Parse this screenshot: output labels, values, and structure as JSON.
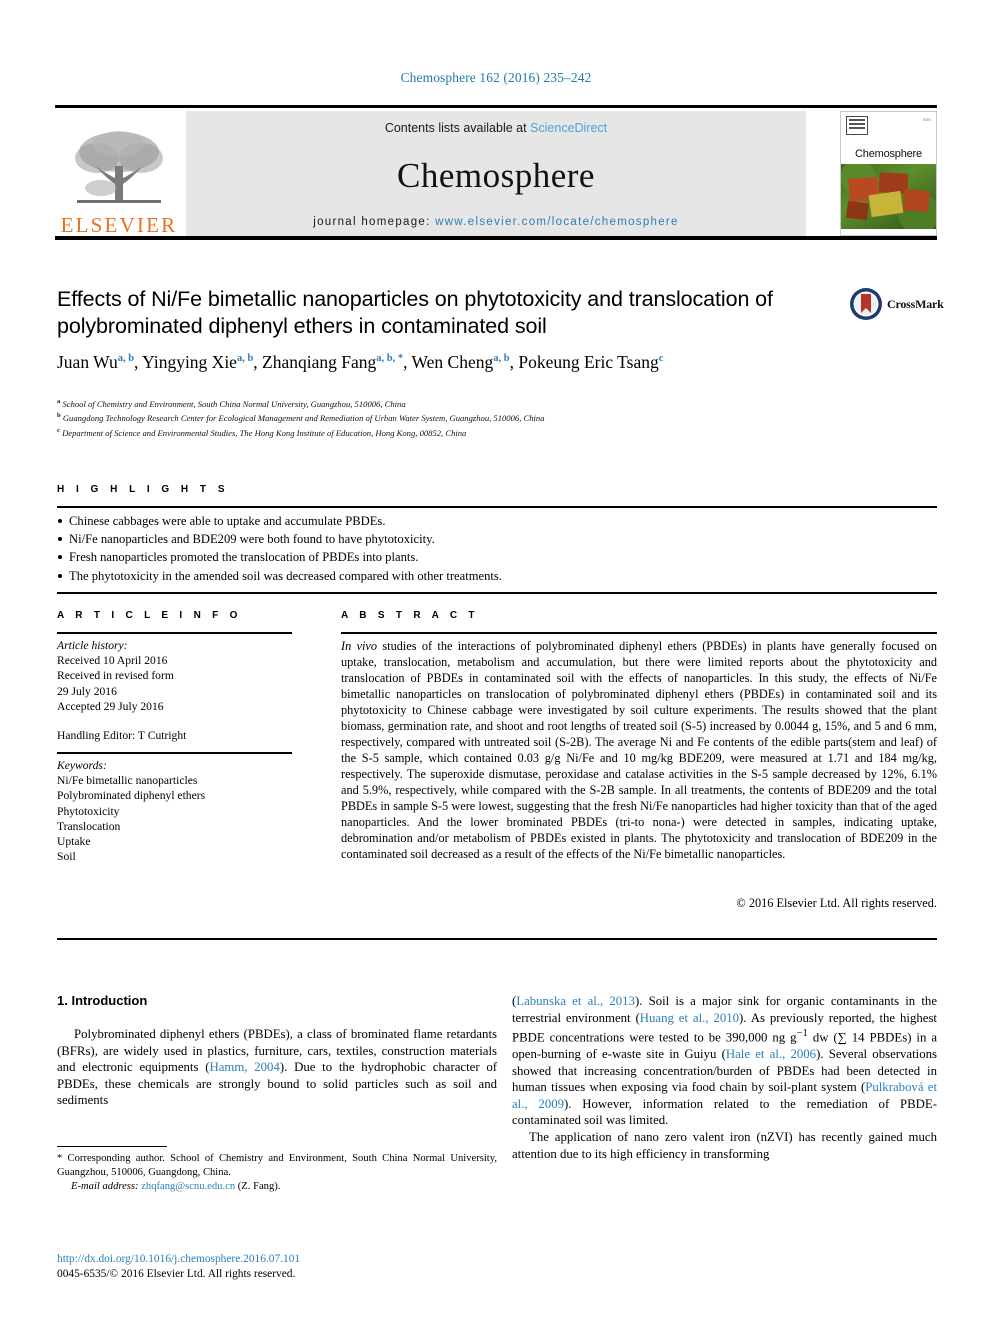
{
  "citation_line": "Chemosphere 162 (2016) 235–242",
  "masthead": {
    "publisher": "ELSEVIER",
    "contents_prefix": "Contents lists available at ",
    "contents_link": "ScienceDirect",
    "journal_name": "Chemosphere",
    "homepage_prefix": "journal homepage: ",
    "homepage_url": "www.elsevier.com/locate/chemosphere",
    "cover_title": "Chemosphere"
  },
  "article": {
    "title": "Effects of Ni/Fe bimetallic nanoparticles on phytotoxicity and translocation of polybrominated diphenyl ethers in contaminated soil",
    "crossmark_label": "CrossMark",
    "authors": [
      {
        "name": "Juan Wu",
        "marks": "a, b"
      },
      {
        "name": "Yingying Xie",
        "marks": "a, b"
      },
      {
        "name": "Zhanqiang Fang",
        "marks": "a, b, *"
      },
      {
        "name": "Wen Cheng",
        "marks": "a, b"
      },
      {
        "name": "Pokeung Eric Tsang",
        "marks": "c"
      }
    ],
    "affiliations": [
      {
        "mark": "a",
        "text": "School of Chemistry and Environment, South China Normal University, Guangzhou, 510006, China"
      },
      {
        "mark": "b",
        "text": "Guangdong Technology Research Center for Ecological Management and Remediation of Urban Water System, Guangzhou, 510006, China"
      },
      {
        "mark": "c",
        "text": "Department of Science and Environmental Studies, The Hong Kong Institute of Education, Hong Kong, 00852, China"
      }
    ]
  },
  "highlights": {
    "heading": "H I G H L I G H T S",
    "items": [
      "Chinese cabbages were able to uptake and accumulate PBDEs.",
      "Ni/Fe nanoparticles and BDE209 were both found to have phytotoxicity.",
      "Fresh nanoparticles promoted the translocation of PBDEs into plants.",
      "The phytotoxicity in the amended soil was decreased compared with other treatments."
    ]
  },
  "article_info": {
    "heading": "A R T I C L E   I N F O",
    "history_label": "Article history:",
    "history_lines": [
      "Received 10 April 2016",
      "Received in revised form",
      "29 July 2016",
      "Accepted 29 July 2016"
    ],
    "handling_editor": "Handling Editor: T Cutright",
    "keywords_label": "Keywords:",
    "keywords": [
      "Ni/Fe bimetallic nanoparticles",
      "Polybrominated diphenyl ethers",
      "Phytotoxicity",
      "Translocation",
      "Uptake",
      "Soil"
    ]
  },
  "abstract": {
    "heading": "A B S T R A C T",
    "lead_italic": "In vivo",
    "text": " studies of the interactions of polybrominated diphenyl ethers (PBDEs) in plants have generally focused on uptake, translocation, metabolism and accumulation, but there were limited reports about the phytotoxicity and translocation of PBDEs in contaminated soil with the effects of nanoparticles. In this study, the effects of Ni/Fe bimetallic nanoparticles on translocation of polybrominated diphenyl ethers (PBDEs) in contaminated soil and its phytotoxicity to Chinese cabbage were investigated by soil culture experiments. The results showed that the plant biomass, germination rate, and shoot and root lengths of treated soil (S-5) increased by 0.0044 g, 15%, and 5 and 6 mm, respectively, compared with untreated soil (S-2B). The average Ni and Fe contents of the edible parts(stem and leaf) of the S-5 sample, which contained 0.03 g/g Ni/Fe and 10 mg/kg BDE209, were measured at 1.71 and 184 mg/kg, respectively. The superoxide dismutase, peroxidase and catalase activities in the S-5 sample decreased by 12%, 6.1% and 5.9%, respectively, while compared with the S-2B sample. In all treatments, the contents of BDE209 and the total PBDEs in sample S-5 were lowest, suggesting that the fresh Ni/Fe nanoparticles had higher toxicity than that of the aged nanoparticles. And the lower brominated PBDEs (tri-to nona-) were detected in samples, indicating uptake, debromination and/or metabolism of PBDEs existed in plants. The phytotoxicity and translocation of BDE209 in the contaminated soil decreased as a result of the effects of the Ni/Fe bimetallic nanoparticles.",
    "copyright": "© 2016 Elsevier Ltd. All rights reserved."
  },
  "body": {
    "section_title": "1. Introduction",
    "left_para_1_a": "Polybrominated diphenyl ethers (PBDEs), a class of brominated flame retardants (BFRs), are widely used in plastics, furniture, cars, textiles, construction materials and electronic equipments (",
    "left_ref_1": "Hamm, 2004",
    "left_para_1_b": "). Due to the hydrophobic character of PBDEs, these chemicals are strongly bound to solid particles such as soil and sediments",
    "right_ref_1": "Labunska et al., 2013",
    "right_para_1_a": "). Soil is a major sink for organic contaminants in the terrestrial environment (",
    "right_ref_2": "Huang et al., 2010",
    "right_para_1_b": "). As previously reported, the highest PBDE concentrations were tested to be 390,000 ng g",
    "right_sup_1": "−1",
    "right_para_1_c": " dw (∑ 14 PBDEs) in a open-burning of e-waste site in Guiyu (",
    "right_ref_3": "Hale et al., 2006",
    "right_para_1_d": "). Several observations showed that increasing concentration/burden of PBDEs had been detected in human tissues when exposing via food chain by soil-plant system (",
    "right_ref_4": "Pulkrabová et al., 2009",
    "right_para_1_e": "). However, information related to the remediation of PBDE-contaminated soil was limited.",
    "right_para_2": "The application of nano zero valent iron (nZVI) has recently gained much attention due to its high efficiency in transforming"
  },
  "footer": {
    "corresponding_mark": "*",
    "corresponding_text": " Corresponding author. School of Chemistry and Environment, South China Normal University, Guangzhou, 510006, Guangdong, China.",
    "email_label": "E-mail address:",
    "email": "zhqfang@scnu.edu.cn",
    "email_suffix": " (Z. Fang).",
    "doi": "http://dx.doi.org/10.1016/j.chemosphere.2016.07.101",
    "issn_line": "0045-6535/© 2016 Elsevier Ltd. All rights reserved."
  },
  "colors": {
    "link_blue": "#2a7fba",
    "elsevier_orange": "#E9711C",
    "crossmark_red": "#b5342a"
  }
}
